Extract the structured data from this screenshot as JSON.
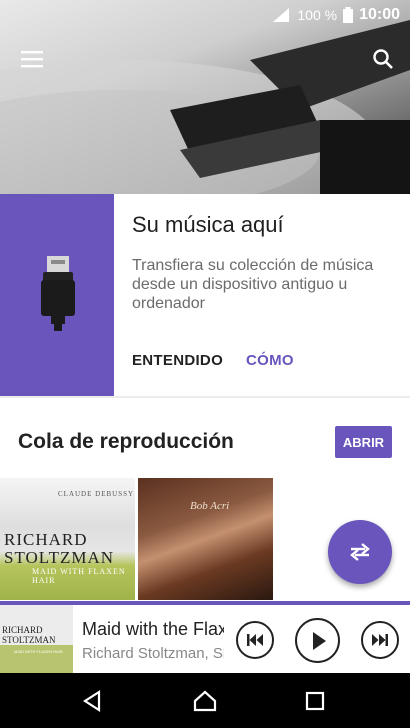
{
  "status_bar": {
    "battery": "100 %",
    "time": "10:00"
  },
  "header": {
    "menu_icon": "hamburger-menu-icon",
    "search_icon": "search-icon"
  },
  "promo_card": {
    "title": "Su música aquí",
    "description": "Transfiera su colección de música desde un dispositivo antiguo u ordenador",
    "dismiss_label": "ENTENDIDO",
    "how_label": "CÓMO",
    "accent": "#6a55bd"
  },
  "queue": {
    "title": "Cola de reproducción",
    "open_label": "ABRIR",
    "albums": [
      {
        "composer": "CLAUDE DEBUSSY",
        "artist_line1": "RICHARD",
        "artist_line2": "STOLTZMAN",
        "album_title": "MAID WITH FLAXEN HAIR"
      },
      {
        "cover_text": "Bob Acri"
      }
    ]
  },
  "now_playing": {
    "title": "Maid with the Flaxen Hair",
    "artist": "Richard Stoltzman, Slovak Radio Symphony Orchestra",
    "thumb_line1": "RICHARD",
    "thumb_line2": "STOLTZMAN",
    "thumb_line3": "MAID WITH FLAXEN HAIR"
  },
  "icons": {
    "fab": "repeat-icon",
    "prev": "skip-previous-icon",
    "play": "play-icon",
    "next": "skip-next-icon",
    "back": "back-icon",
    "home": "home-icon",
    "recents": "recents-icon"
  }
}
